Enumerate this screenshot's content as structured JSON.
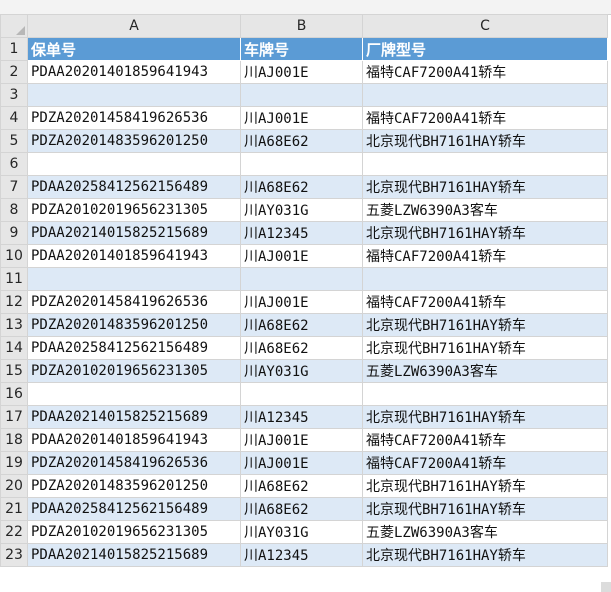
{
  "columns": [
    "A",
    "B",
    "C"
  ],
  "rows": [
    {
      "num": "1",
      "cells": [
        "保单号",
        "车牌号",
        "厂牌型号"
      ],
      "header": true
    },
    {
      "num": "2",
      "cells": [
        "PDAA20201401859641943",
        "川AJ001E",
        "福特CAF7200A41轿车"
      ]
    },
    {
      "num": "3",
      "cells": [
        "",
        "",
        ""
      ]
    },
    {
      "num": "4",
      "cells": [
        "PDZA20201458419626536",
        "川AJ001E",
        "福特CAF7200A41轿车"
      ]
    },
    {
      "num": "5",
      "cells": [
        "PDZA20201483596201250",
        "川A68E62",
        "北京现代BH7161HAY轿车"
      ]
    },
    {
      "num": "6",
      "cells": [
        "",
        "",
        ""
      ]
    },
    {
      "num": "7",
      "cells": [
        "PDAA20258412562156489",
        "川A68E62",
        "北京现代BH7161HAY轿车"
      ]
    },
    {
      "num": "8",
      "cells": [
        "PDZA20102019656231305",
        "川AY031G",
        "五菱LZW6390A3客车"
      ]
    },
    {
      "num": "9",
      "cells": [
        "PDAA20214015825215689",
        "川A12345",
        "北京现代BH7161HAY轿车"
      ]
    },
    {
      "num": "10",
      "cells": [
        "PDAA20201401859641943",
        "川AJ001E",
        "福特CAF7200A41轿车"
      ]
    },
    {
      "num": "11",
      "cells": [
        "",
        "",
        ""
      ]
    },
    {
      "num": "12",
      "cells": [
        "PDZA20201458419626536",
        "川AJ001E",
        "福特CAF7200A41轿车"
      ]
    },
    {
      "num": "13",
      "cells": [
        "PDZA20201483596201250",
        "川A68E62",
        "北京现代BH7161HAY轿车"
      ]
    },
    {
      "num": "14",
      "cells": [
        "PDAA20258412562156489",
        "川A68E62",
        "北京现代BH7161HAY轿车"
      ]
    },
    {
      "num": "15",
      "cells": [
        "PDZA20102019656231305",
        "川AY031G",
        "五菱LZW6390A3客车"
      ]
    },
    {
      "num": "16",
      "cells": [
        "",
        "",
        ""
      ]
    },
    {
      "num": "17",
      "cells": [
        "PDAA20214015825215689",
        "川A12345",
        "北京现代BH7161HAY轿车"
      ]
    },
    {
      "num": "18",
      "cells": [
        "PDAA20201401859641943",
        "川AJ001E",
        "福特CAF7200A41轿车"
      ]
    },
    {
      "num": "19",
      "cells": [
        "PDZA20201458419626536",
        "川AJ001E",
        "福特CAF7200A41轿车"
      ]
    },
    {
      "num": "20",
      "cells": [
        "PDZA20201483596201250",
        "川A68E62",
        "北京现代BH7161HAY轿车"
      ]
    },
    {
      "num": "21",
      "cells": [
        "PDAA20258412562156489",
        "川A68E62",
        "北京现代BH7161HAY轿车"
      ]
    },
    {
      "num": "22",
      "cells": [
        "PDZA20102019656231305",
        "川AY031G",
        "五菱LZW6390A3客车"
      ]
    },
    {
      "num": "23",
      "cells": [
        "PDAA20214015825215689",
        "川A12345",
        "北京现代BH7161HAY轿车"
      ]
    }
  ],
  "colors": {
    "header_fill": "#5b9bd5",
    "band_fill": "#dde9f6",
    "header_text": "#ffffff"
  }
}
